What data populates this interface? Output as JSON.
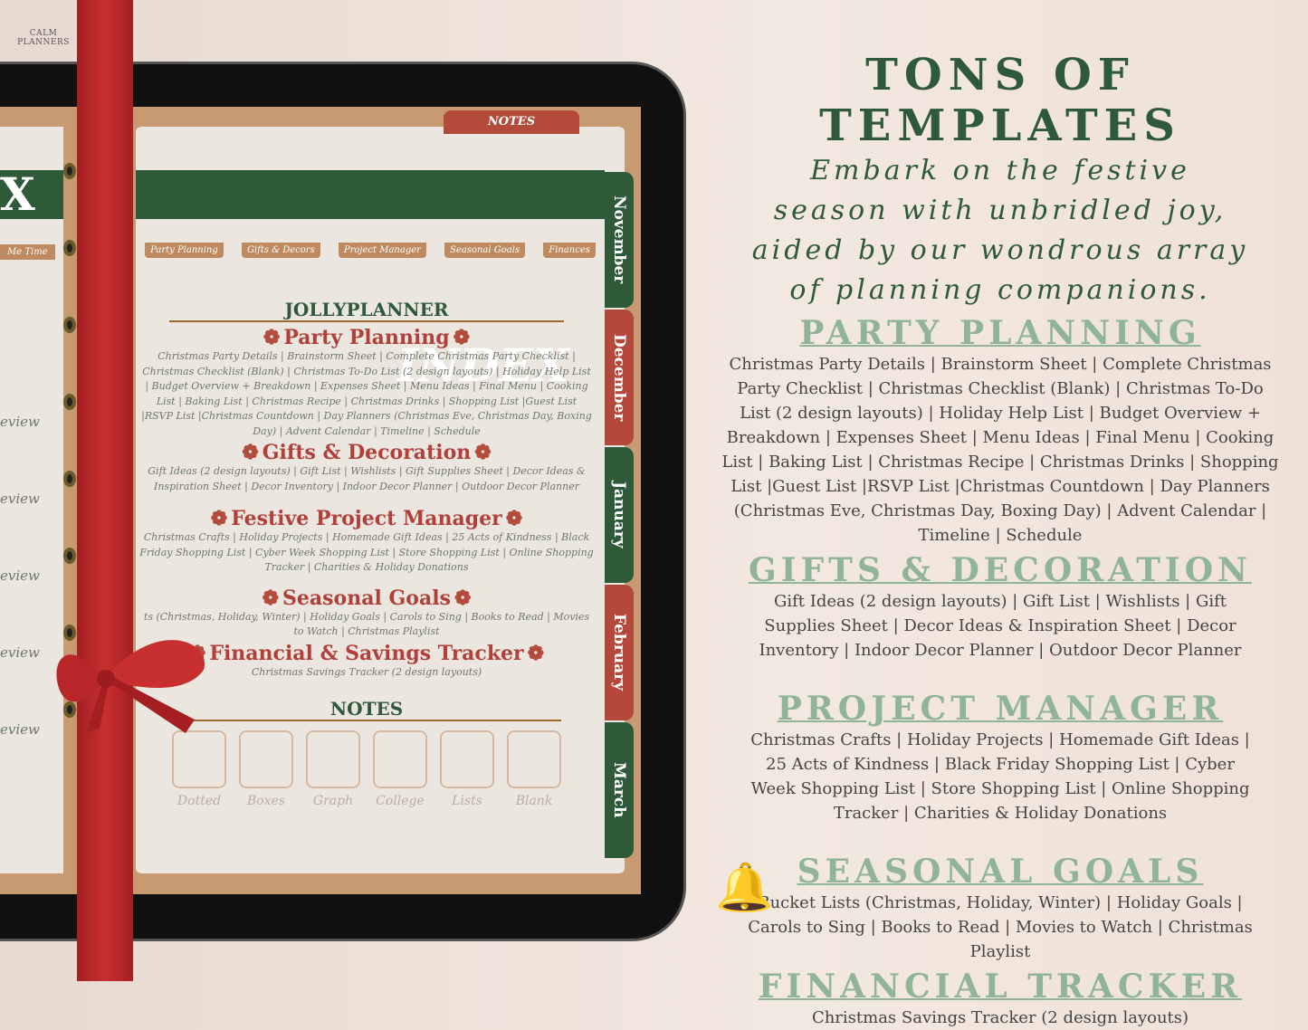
{
  "brand": "CALM PLANNERS",
  "tablet": {
    "notes_tab": "NOTES",
    "index_title": "INDEX",
    "left_band": "X",
    "left_tab": "Me Time",
    "tabs": [
      "Party Planning",
      "Gifts & Decors",
      "Project Manager",
      "Seasonal Goals",
      "Finances"
    ],
    "side_tabs": [
      {
        "label": "November",
        "color": "#2f5a3a"
      },
      {
        "label": "December",
        "color": "#b4483a"
      },
      {
        "label": "January",
        "color": "#2f5a3a"
      },
      {
        "label": "February",
        "color": "#b4483a"
      },
      {
        "label": "March",
        "color": "#2f5a3a"
      }
    ],
    "left_page_items": [
      "eview",
      "eview",
      "eview",
      "eview",
      "eview"
    ],
    "planner_name": "JOLLYPLANNER",
    "sections": [
      {
        "title": "Party Planning",
        "body": "Christmas Party Details | Brainstorm Sheet | Complete Christmas Party Checklist | Christmas Checklist (Blank) | Christmas To-Do List (2 design layouts) | Holiday Help List | Budget Overview + Breakdown | Expenses Sheet | Menu Ideas | Final Menu | Cooking List | Baking List | Christmas Recipe | Christmas Drinks | Shopping List |Guest List |RSVP List |Christmas Countdown | Day Planners (Christmas Eve, Christmas Day, Boxing Day) | Advent Calendar | Timeline | Schedule"
      },
      {
        "title": "Gifts & Decoration",
        "body": "Gift Ideas (2 design layouts) | Gift List | Wishlists | Gift Supplies Sheet | Decor Ideas & Inspiration Sheet | Decor Inventory | Indoor Decor Planner | Outdoor Decor Planner"
      },
      {
        "title": "Festive Project Manager",
        "body": "Christmas Crafts | Holiday Projects | Homemade Gift Ideas | 25 Acts of Kindness | Black Friday Shopping List | Cyber Week Shopping List | Store Shopping List | Online Shopping Tracker | Charities & Holiday Donations"
      },
      {
        "title": "Seasonal Goals",
        "body": "ts (Christmas, Holiday, Winter) | Holiday Goals | Carols to Sing | Books to Read | Movies to Watch | Christmas Playlist"
      },
      {
        "title": "Financial & Savings Tracker",
        "body": "Christmas Savings Tracker (2 design layouts)"
      }
    ],
    "notes_heading": "NOTES",
    "notes": [
      "Dotted",
      "Boxes",
      "Graph",
      "College",
      "Lists",
      "Blank"
    ]
  },
  "promo": {
    "title": "TONS OF TEMPLATES",
    "subtitle": "Embark on the festive season with unbridled joy, aided by our wondrous array of planning companions.",
    "sections": [
      {
        "heading": "PARTY PLANNING",
        "body": "Christmas Party Details | Brainstorm Sheet | Complete Christmas Party Checklist | Christmas Checklist (Blank) | Christmas To-Do List (2 design layouts) | Holiday Help List | Budget Overview + Breakdown | Expenses Sheet | Menu Ideas | Final Menu | Cooking List | Baking List | Christmas Recipe | Christmas Drinks | Shopping List |Guest List |RSVP List |Christmas Countdown |  Day Planners (Christmas Eve, Christmas Day, Boxing Day) | Advent Calendar |  Timeline | Schedule"
      },
      {
        "heading": "GIFTS & DECORATION",
        "body": "Gift Ideas (2 design layouts) | Gift List | Wishlists | Gift Supplies Sheet | Decor Ideas & Inspiration Sheet | Decor Inventory | Indoor Decor Planner | Outdoor Decor Planner"
      },
      {
        "heading": "PROJECT MANAGER",
        "body": "Christmas Crafts | Holiday Projects | Homemade Gift Ideas | 25 Acts of Kindness | Black Friday Shopping List | Cyber Week Shopping List | Store Shopping List | Online Shopping Tracker | Charities & Holiday Donations"
      },
      {
        "heading": "SEASONAL GOALS",
        "body": "Bucket Lists (Christmas, Holiday, Winter) | Holiday Goals | Carols to Sing | Books to Read | Movies to Watch | Christmas Playlist"
      },
      {
        "heading": "FINANCIAL TRACKER",
        "body": "Christmas Savings Tracker (2 design layouts)"
      }
    ]
  },
  "colors": {
    "dark_green": "#2f5a3a",
    "light_green": "#8fb596",
    "red": "#b2403a",
    "ribbon": "#c02a2b"
  }
}
